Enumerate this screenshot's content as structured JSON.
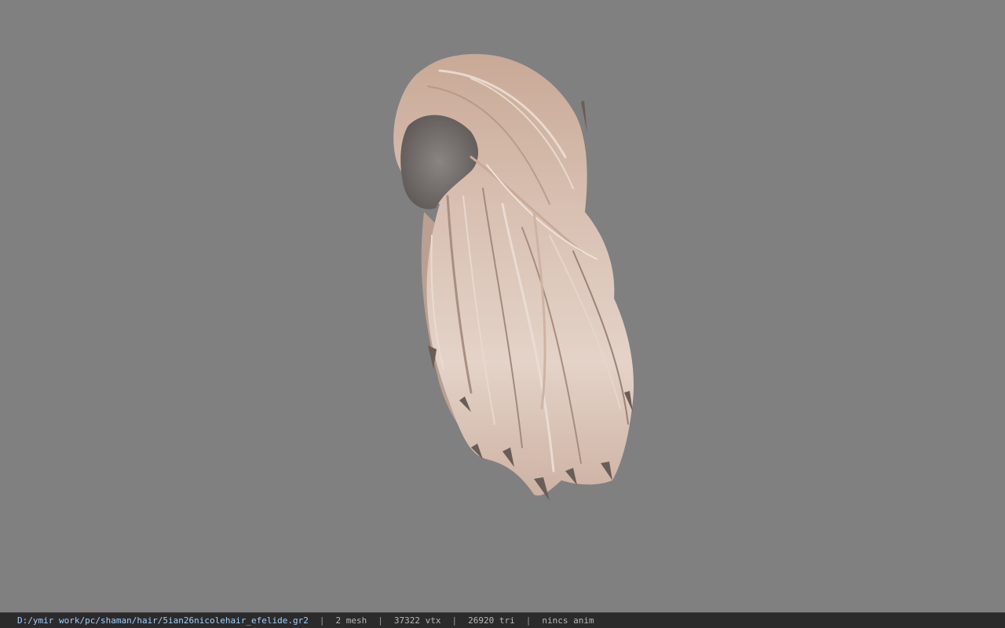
{
  "status_bar": {
    "file_path": "D:/ymir work/pc/shaman/hair/5ian26nicolehair_efelide.gr2",
    "separator": "|",
    "mesh_count": "2 mesh",
    "vertex_count": "37322 vtx",
    "triangle_count": "26920 tri",
    "anim_status": "nincs anim"
  },
  "viewport": {
    "background_color": "#808080",
    "model": "hair-model"
  },
  "colors": {
    "hair_light": "#e2cfc3",
    "hair_mid": "#c9ad9c",
    "hair_dark": "#6f625c",
    "path_text": "#9fd0ff"
  }
}
